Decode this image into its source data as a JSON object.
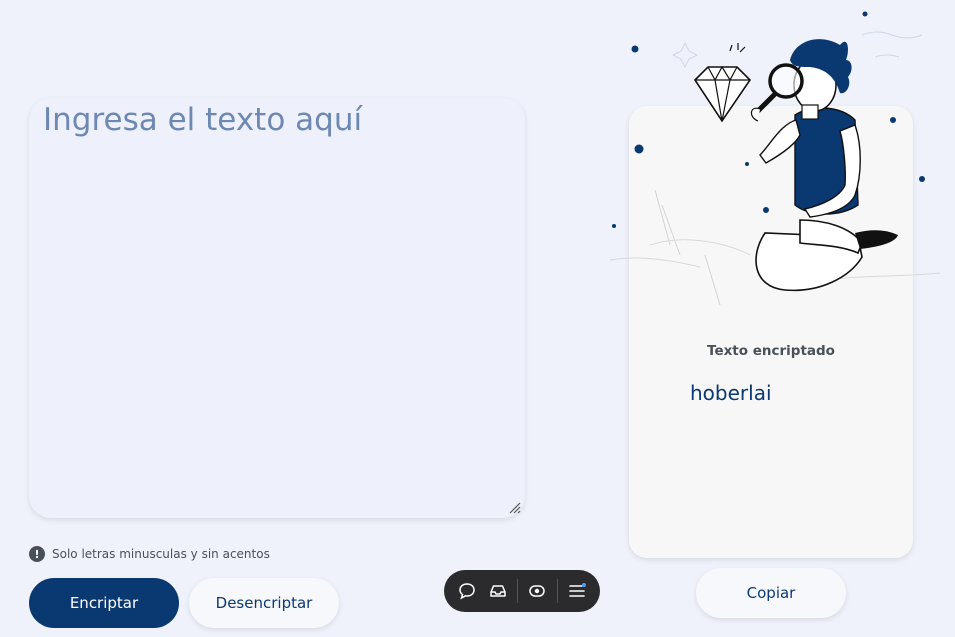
{
  "input": {
    "placeholder": "Ingresa el texto aquí",
    "value": ""
  },
  "note": {
    "icon": "info-icon",
    "text": "Solo letras minusculas y sin acentos"
  },
  "buttons": {
    "encrypt": "Encriptar",
    "decrypt": "Desencriptar",
    "copy": "Copiar"
  },
  "output": {
    "title": "Texto encriptado",
    "text": "hoberlai"
  },
  "toolbar": {
    "items": [
      "comment-icon",
      "inbox-icon",
      "eye-icon",
      "menu-icon"
    ]
  },
  "colors": {
    "primary": "#0a3871",
    "background": "#eff2fb",
    "card": "#f8f7f8",
    "toolbar": "#2b2b2e"
  }
}
